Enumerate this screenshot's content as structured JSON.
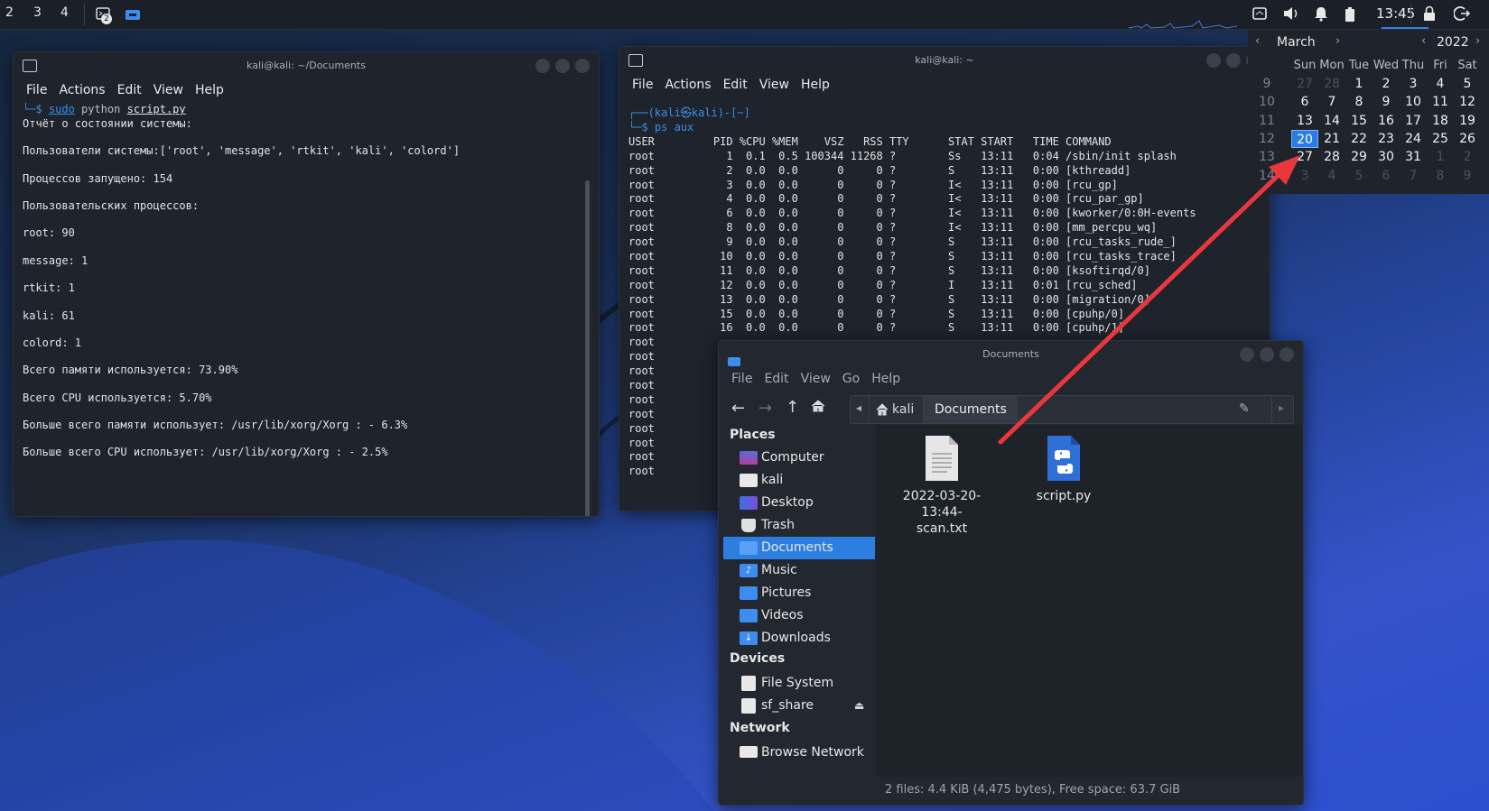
{
  "taskbar": {
    "workspaces": [
      "2",
      "3",
      "4"
    ],
    "terminal_badge": "2",
    "clock": "13:45"
  },
  "term1": {
    "title": "kali@kali: ~/Documents",
    "menu": [
      "File",
      "Actions",
      "Edit",
      "View",
      "Help"
    ],
    "prompt_prefix": "└─$ ",
    "cmd_sudo": "sudo",
    "cmd_python": " python ",
    "cmd_script": "script.py",
    "lines": [
      "Отчёт о состоянии системы:",
      "",
      "Пользователи системы:['root', 'message', 'rtkit', 'kali', 'colord']",
      "",
      "Процессов запущено: 154",
      "",
      "Пользовательских процессов:",
      "",
      "root: 90",
      "",
      "message: 1",
      "",
      "rtkit: 1",
      "",
      "kali: 61",
      "",
      "colord: 1",
      "",
      "Всего памяти используется: 73.90%",
      "",
      "Всего CPU используется: 5.70%",
      "",
      "Больше всего памяти использует: /usr/lib/xorg/Xorg : - 6.3%",
      "",
      "Больше всего CPU использует: /usr/lib/xorg/Xorg : - 2.5%"
    ]
  },
  "term2": {
    "title": "kali@kali: ~",
    "menu": [
      "File",
      "Actions",
      "Edit",
      "View",
      "Help"
    ],
    "prompt_user": "┌──(kali㉿kali)-[~]",
    "prompt_cmd": "└─$ ps aux",
    "header": "USER         PID %CPU %MEM    VSZ   RSS TTY      STAT START   TIME COMMAND",
    "rows": [
      "root           1  0.1  0.5 100344 11268 ?        Ss   13:11   0:04 /sbin/init splash",
      "root           2  0.0  0.0      0     0 ?        S    13:11   0:00 [kthreadd]",
      "root           3  0.0  0.0      0     0 ?        I<   13:11   0:00 [rcu_gp]",
      "root           4  0.0  0.0      0     0 ?        I<   13:11   0:00 [rcu_par_gp]",
      "root           6  0.0  0.0      0     0 ?        I<   13:11   0:00 [kworker/0:0H-events",
      "root           8  0.0  0.0      0     0 ?        I<   13:11   0:00 [mm_percpu_wq]",
      "root           9  0.0  0.0      0     0 ?        S    13:11   0:00 [rcu_tasks_rude_]",
      "root          10  0.0  0.0      0     0 ?        S    13:11   0:00 [rcu_tasks_trace]",
      "root          11  0.0  0.0      0     0 ?        S    13:11   0:00 [ksoftirqd/0]",
      "root          12  0.0  0.0      0     0 ?        I    13:11   0:01 [rcu_sched]",
      "root          13  0.0  0.0      0     0 ?        S    13:11   0:00 [migration/0]",
      "root          15  0.0  0.0      0     0 ?        S    13:11   0:00 [cpuhp/0]",
      "root          16  0.0  0.0      0     0 ?        S    13:11   0:00 [cpuhp/1]",
      "root",
      "root",
      "root",
      "root",
      "root",
      "root",
      "root",
      "root",
      "root",
      "root"
    ]
  },
  "fm": {
    "title": "Documents",
    "menu": [
      "File",
      "Edit",
      "View",
      "Go",
      "Help"
    ],
    "crumbs": [
      "kali",
      "Documents"
    ],
    "places_heading": "Places",
    "places": [
      "Computer",
      "kali",
      "Desktop",
      "Trash",
      "Documents",
      "Music",
      "Pictures",
      "Videos",
      "Downloads"
    ],
    "devices_heading": "Devices",
    "devices": [
      "File System",
      "sf_share"
    ],
    "network_heading": "Network",
    "network": [
      "Browse Network"
    ],
    "files": [
      {
        "name_line1": "2022-03-20-13:44-",
        "name_line2": "scan.txt",
        "type": "text-file-icon"
      },
      {
        "name_line1": "script.py",
        "name_line2": "",
        "type": "python-file-icon"
      }
    ],
    "status": "2 files: 4.4 KiB (4,475 bytes), Free space: 63.7 GiB"
  },
  "calendar": {
    "month": "March",
    "year": "2022",
    "weekday_headers": [
      "Sun",
      "Mon",
      "Tue",
      "Wed",
      "Thu",
      "Fri",
      "Sat"
    ],
    "weeks": [
      {
        "week": "9",
        "days": [
          "27",
          "28",
          "1",
          "2",
          "3",
          "4",
          "5"
        ],
        "dim": [
          true,
          true,
          false,
          false,
          false,
          false,
          false
        ]
      },
      {
        "week": "10",
        "days": [
          "6",
          "7",
          "8",
          "9",
          "10",
          "11",
          "12"
        ],
        "dim": [
          false,
          false,
          false,
          false,
          false,
          false,
          false
        ]
      },
      {
        "week": "11",
        "days": [
          "13",
          "14",
          "15",
          "16",
          "17",
          "18",
          "19"
        ],
        "dim": [
          false,
          false,
          false,
          false,
          false,
          false,
          false
        ]
      },
      {
        "week": "12",
        "days": [
          "20",
          "21",
          "22",
          "23",
          "24",
          "25",
          "26"
        ],
        "dim": [
          false,
          false,
          false,
          false,
          false,
          false,
          false
        ]
      },
      {
        "week": "13",
        "days": [
          "27",
          "28",
          "29",
          "30",
          "31",
          "1",
          "2"
        ],
        "dim": [
          false,
          false,
          false,
          false,
          false,
          true,
          true
        ]
      },
      {
        "week": "14",
        "days": [
          "3",
          "4",
          "5",
          "6",
          "7",
          "8",
          "9"
        ],
        "dim": [
          true,
          true,
          true,
          true,
          true,
          true,
          true
        ]
      }
    ],
    "today": "20"
  },
  "colors": {
    "accent": "#2c7ee0",
    "arrow": "#e8383d",
    "prompt_blue": "#3a8ee6"
  }
}
